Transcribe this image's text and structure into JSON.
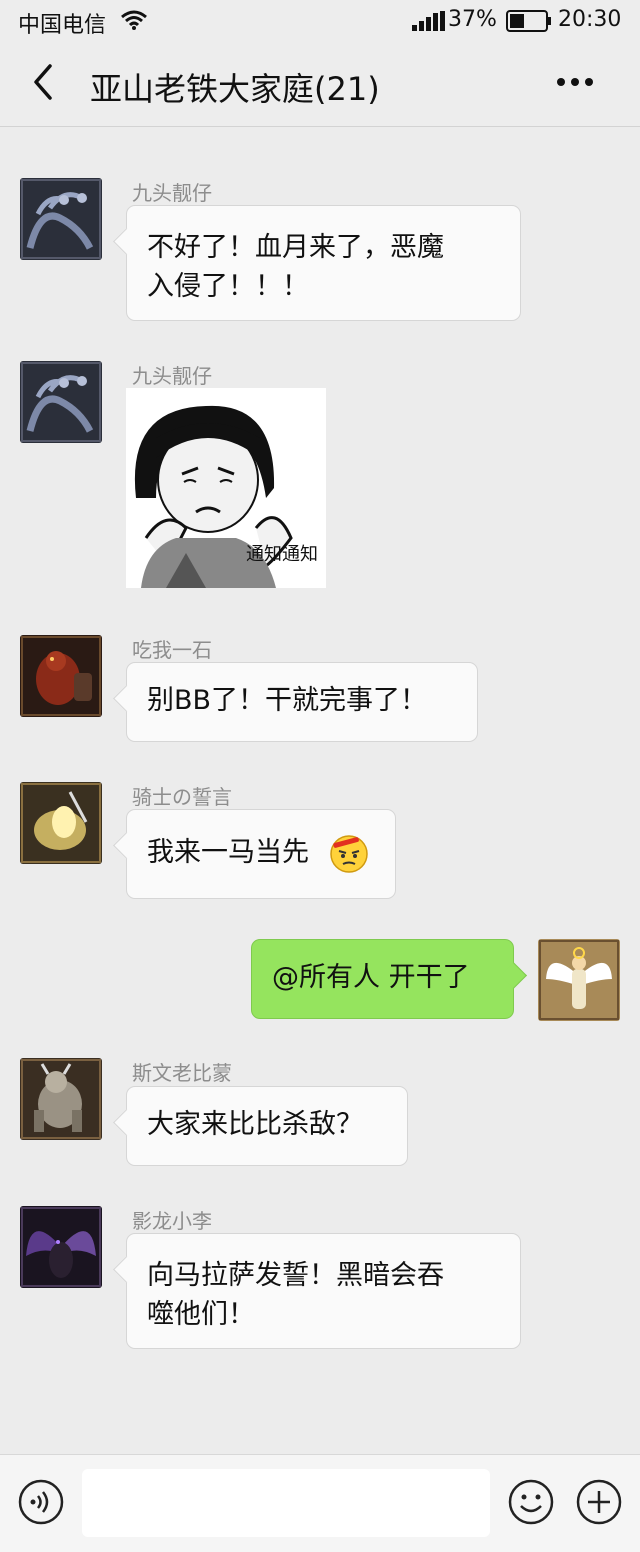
{
  "status": {
    "carrier": "中国电信",
    "battery_pct": "37%",
    "time": "20:30"
  },
  "nav": {
    "title": "亚山老铁大家庭(21)",
    "back_icon": "chevron-left-icon",
    "more_icon": "more-dots-icon"
  },
  "messages": [
    {
      "sender": "九头靓仔",
      "text_line1": "不好了！血月来了，恶魔",
      "text_line2": "入侵了！！！",
      "avatar": "hydra-avatar"
    },
    {
      "sender": "九头靓仔",
      "sticker_caption": "通知通知",
      "avatar": "hydra-avatar"
    },
    {
      "sender": "吃我一石",
      "text": "别BB了！干就完事了！",
      "avatar": "golem-avatar"
    },
    {
      "sender": "骑士の誓言",
      "text": "我来一马当先",
      "avatar": "knight-avatar",
      "emoji": "annoyed-face-emoji"
    },
    {
      "self": true,
      "text": "@所有人 开干了",
      "avatar": "angel-avatar"
    },
    {
      "sender": "斯文老比蒙",
      "text": "大家来比比杀敌？",
      "avatar": "behemoth-avatar"
    },
    {
      "sender": "影龙小李",
      "text_line1": "向马拉萨发誓！黑暗会吞",
      "text_line2": "噬他们！",
      "avatar": "shadow-dragon-avatar"
    }
  ],
  "input": {
    "placeholder": "",
    "voice_icon": "voice-icon",
    "emoji_icon": "emoji-icon",
    "plus_icon": "plus-icon"
  },
  "colors": {
    "background": "#ececec",
    "self_bubble": "#95e45e",
    "other_bubble": "#fafafa",
    "sender_name": "#8d8d8d"
  }
}
